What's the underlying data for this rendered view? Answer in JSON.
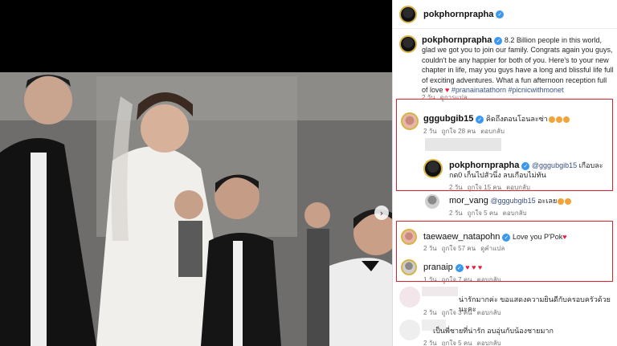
{
  "post_owner": "pokphornprapha",
  "caption": {
    "username": "pokphornprapha",
    "text": "8.2 Billion people in this world, glad we got you to join our family. Congrats again you guys, couldn't be any happier for both of you. Here's to your new chapter in life, may you guys have a long and blissful life full of exciting adventures. What a fun afternoon reception full of love",
    "hashtag1": "#pranainatathorn",
    "hashtag2": "#picnicwithmonet",
    "meta_time": "2 วัน",
    "meta_extra": "ดูการแปล"
  },
  "comments": [
    {
      "username": "gggubgib15",
      "text": "คิดถึงตอนโอนละซ่า",
      "time": "2 วัน",
      "likes": "ถูกใจ 28 คน",
      "reply": "ตอบกลับ"
    },
    {
      "username": "pokphornprapha",
      "mention": "@gggubgib15",
      "text": "เกือบละ กด0 เก็นไปสัวนึ่ง ลบเกือบไม่ทัน",
      "time": "2 วัน",
      "likes": "ถูกใจ 15 คน",
      "reply": "ตอบกลับ"
    },
    {
      "username": "mor_vang",
      "mention": "@gggubgib15",
      "text": "อะเลย",
      "time": "2 วัน",
      "likes": "ถูกใจ 5 คน",
      "reply": "ตอบกลับ"
    },
    {
      "username": "taewaew_natapohn",
      "text": "Love you P'Pok",
      "time": "2 วัน",
      "likes": "ถูกใจ 57 คน",
      "reply": "ดูคำแปล"
    },
    {
      "username": "pranaip",
      "time": "1 วัน",
      "likes": "ถูกใจ 7 คน",
      "reply": "ตอบกลับ"
    },
    {
      "text": "น่ารักมากค่ะ ขอแสดงความยินดีกับครอบครัวด้วยนะคะ",
      "time": "2 วัน",
      "likes": "ถูกใจ 3 คน",
      "reply": "ตอบกลับ"
    },
    {
      "text": "เป็นพี่ชายที่น่ารัก อบอุ่นกับน้องชายมาก",
      "time": "2 วัน",
      "likes": "ถูกใจ 5 คน",
      "reply": "ตอบกลับ"
    }
  ],
  "colors": {
    "highlight_border": "#e0212c",
    "verified": "#3897f0",
    "heart": "#ed1c3b"
  }
}
